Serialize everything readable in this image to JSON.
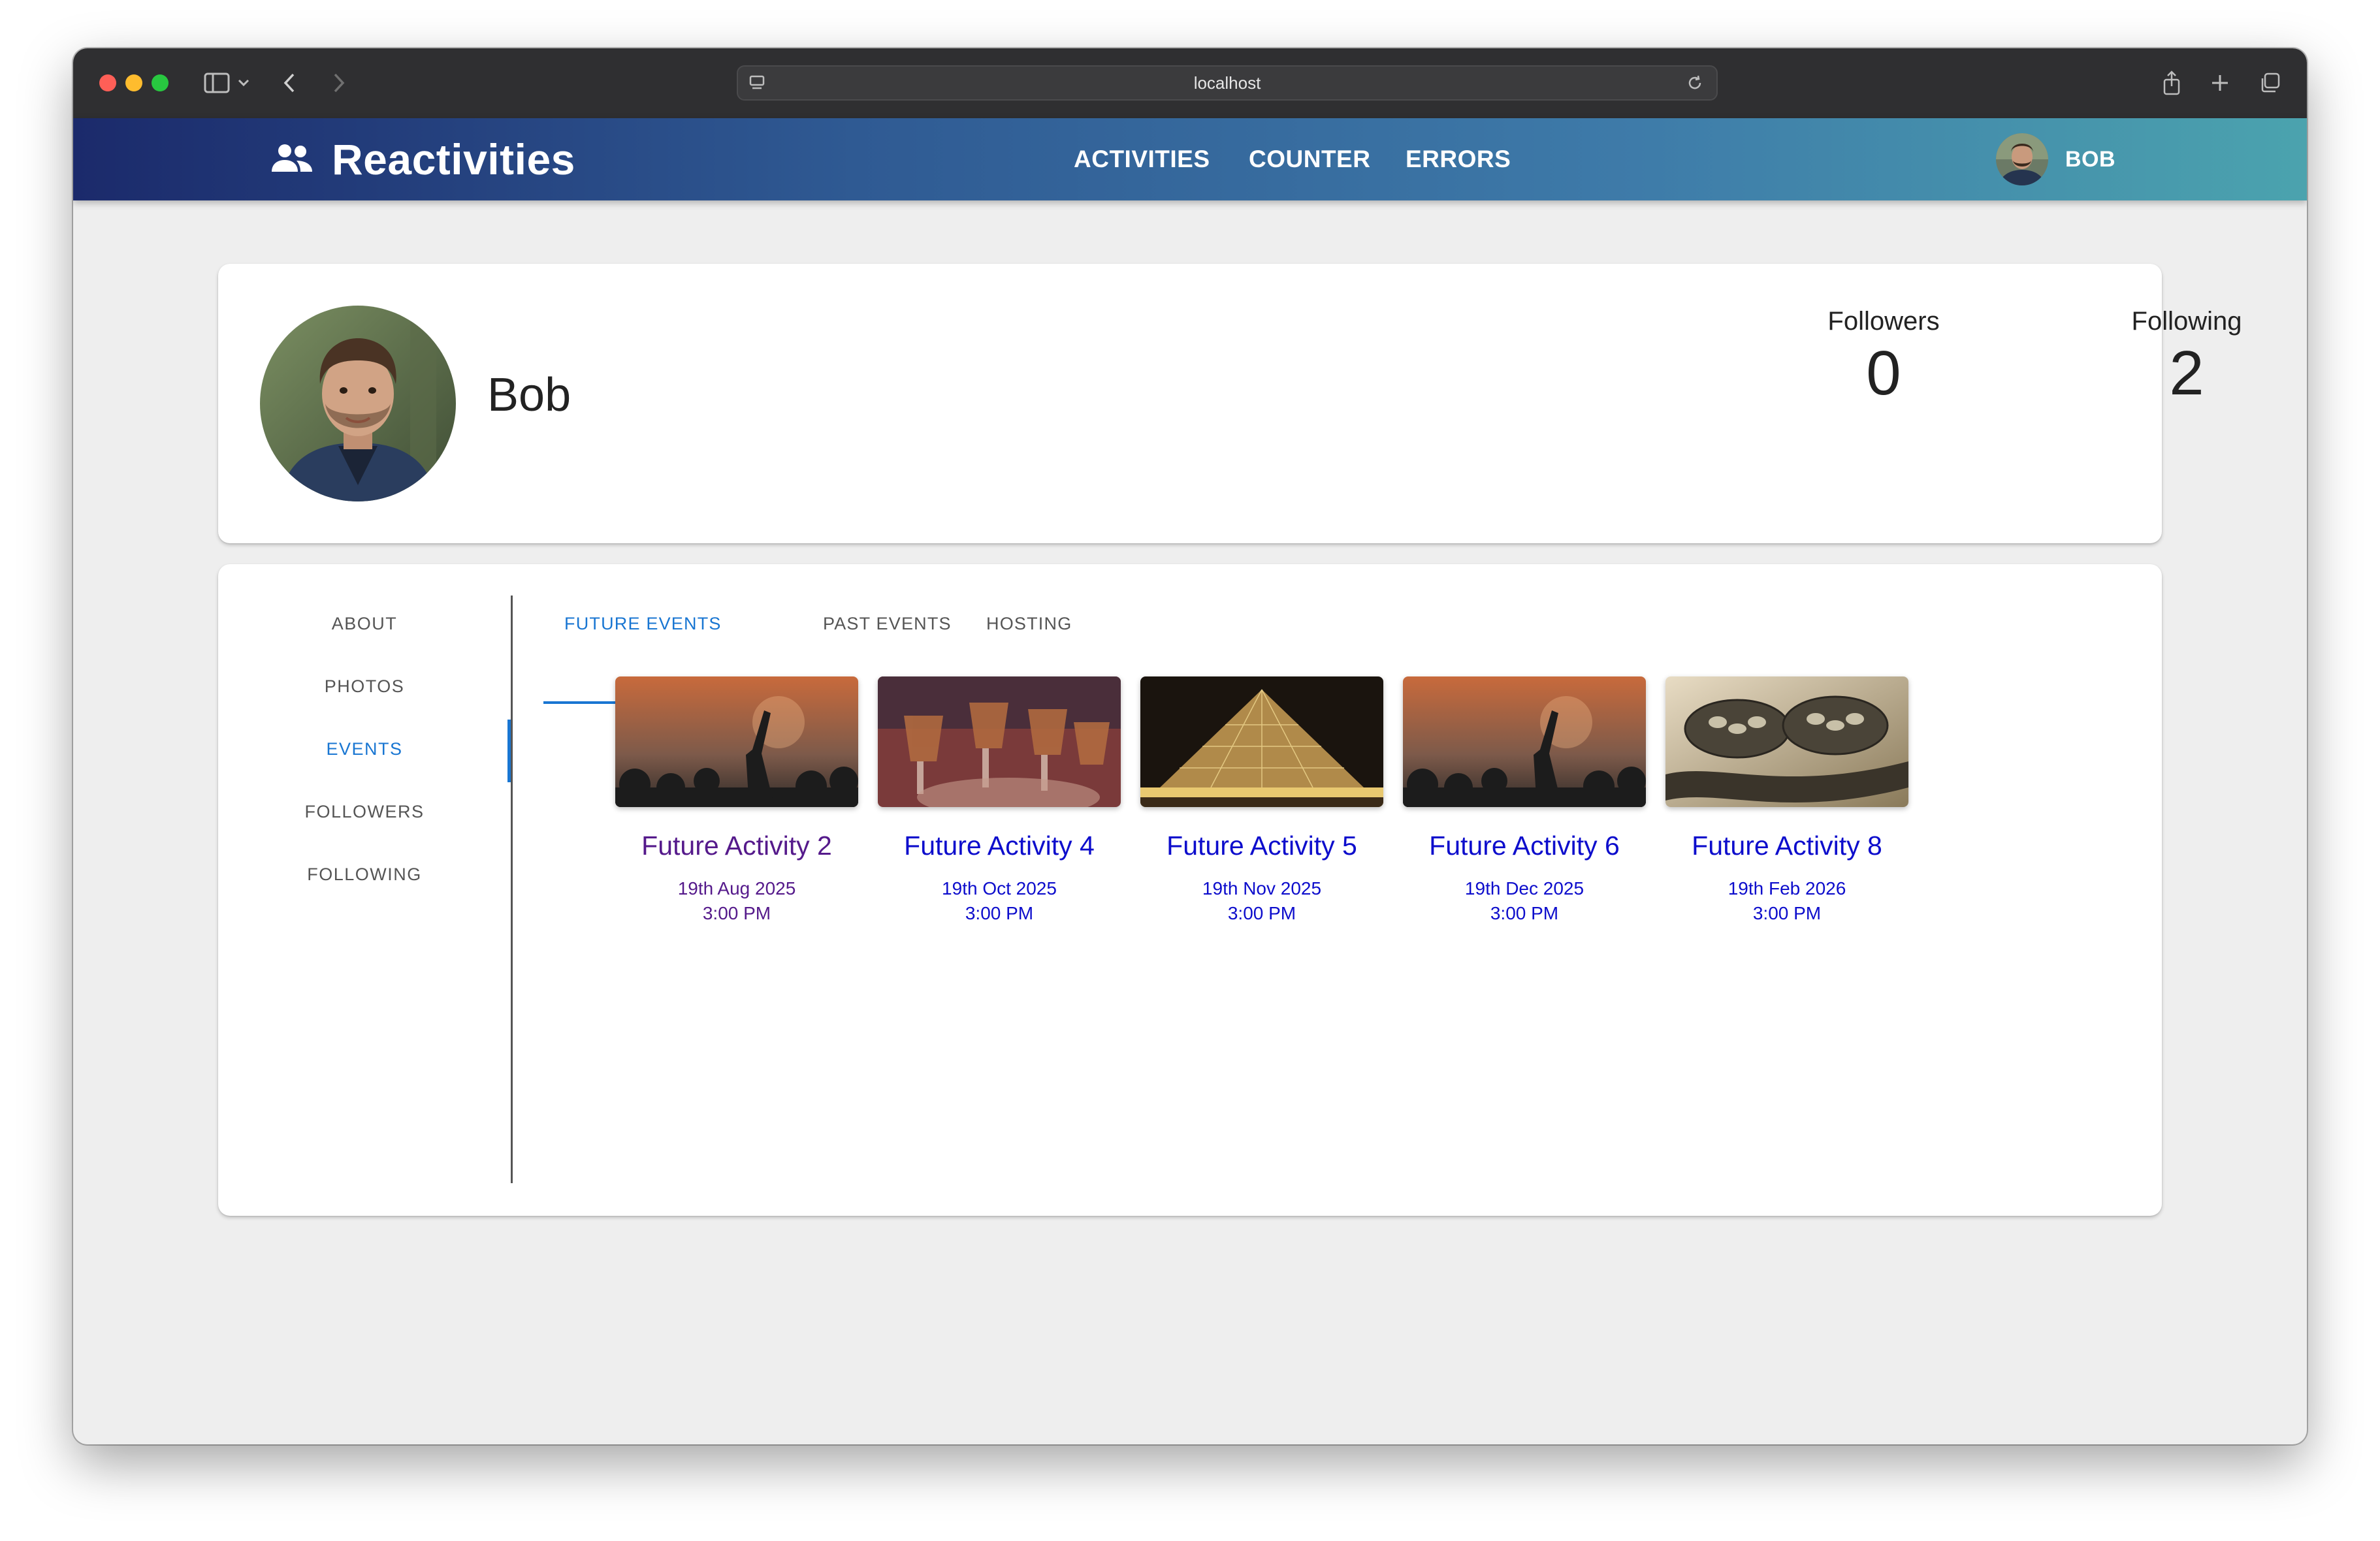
{
  "browser": {
    "url": "localhost"
  },
  "navbar": {
    "brand": "Reactivities",
    "links": [
      "ACTIVITIES",
      "COUNTER",
      "ERRORS"
    ],
    "user": "BOB",
    "gradient": [
      "#1b2a6b",
      "#4ba3ae"
    ]
  },
  "profile": {
    "name": "Bob",
    "followers_label": "Followers",
    "followers_count": "0",
    "following_label": "Following",
    "following_count": "2"
  },
  "sidebar": {
    "items": [
      "ABOUT",
      "PHOTOS",
      "EVENTS",
      "FOLLOWERS",
      "FOLLOWING"
    ],
    "active": "EVENTS"
  },
  "tabs": {
    "items": [
      "FUTURE EVENTS",
      "PAST EVENTS",
      "HOSTING"
    ],
    "active": "FUTURE EVENTS"
  },
  "events": [
    {
      "title": "Future Activity 2",
      "date": "19th Aug 2025",
      "time": "3:00 PM",
      "image": "concert-crowd",
      "visited": true
    },
    {
      "title": "Future Activity 4",
      "date": "19th Oct 2025",
      "time": "3:00 PM",
      "image": "drinks-toast",
      "visited": false
    },
    {
      "title": "Future Activity 5",
      "date": "19th Nov 2025",
      "time": "3:00 PM",
      "image": "louvre-pyramid",
      "visited": false
    },
    {
      "title": "Future Activity 6",
      "date": "19th Dec 2025",
      "time": "3:00 PM",
      "image": "concert-crowd",
      "visited": false
    },
    {
      "title": "Future Activity 8",
      "date": "19th Feb 2026",
      "time": "3:00 PM",
      "image": "film-reels",
      "visited": false
    }
  ],
  "colors": {
    "accent": "#1976d2",
    "link": "#0d0dcc",
    "visited_link": "#551a8b"
  }
}
